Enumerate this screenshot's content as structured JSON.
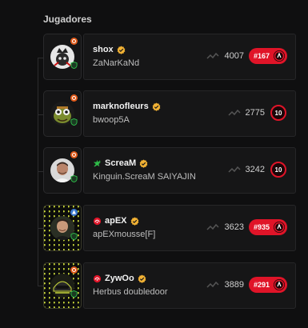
{
  "section_title": "Jugadores",
  "colors": {
    "background": "#0f0f10",
    "card": "#161617",
    "accent_red": "#e01428",
    "verified_gold": "#f2b234",
    "online_green": "#2fbf4a"
  },
  "players": [
    {
      "nickname": "shox",
      "subtitle": "ZaNarKaNd",
      "elo": "4007",
      "rank_pill": "#167",
      "level": null,
      "verified": true,
      "has_rank_icon": false,
      "leader_icon": false,
      "avatar_icon": "crown-skull-avatar",
      "highlight_frame": false
    },
    {
      "nickname": "marknofleurs",
      "subtitle": "bwoop5A",
      "elo": "2775",
      "rank_pill": null,
      "level": "10",
      "verified": true,
      "has_rank_icon": false,
      "leader_icon": false,
      "avatar_icon": "cartoon-frog-avatar",
      "highlight_frame": false
    },
    {
      "nickname": "ScreaM",
      "subtitle": "Kinguin.ScreaM SAIYAJIN",
      "elo": "3242",
      "rank_pill": null,
      "level": "10",
      "verified": true,
      "has_rank_icon": false,
      "leader_icon": true,
      "avatar_icon": "person-portrait-avatar",
      "highlight_frame": false
    },
    {
      "nickname": "apEX",
      "subtitle": "apEXmousse[F]",
      "elo": "3623",
      "rank_pill": "#935",
      "level": null,
      "verified": true,
      "has_rank_icon": true,
      "leader_icon": false,
      "avatar_icon": "person-portrait-avatar",
      "highlight_frame": true
    },
    {
      "nickname": "ZywOo",
      "subtitle": "Herbus doubledoor",
      "elo": "3889",
      "rank_pill": "#291",
      "level": null,
      "verified": true,
      "has_rank_icon": true,
      "leader_icon": false,
      "avatar_icon": "helmet-avatar",
      "highlight_frame": true
    }
  ]
}
